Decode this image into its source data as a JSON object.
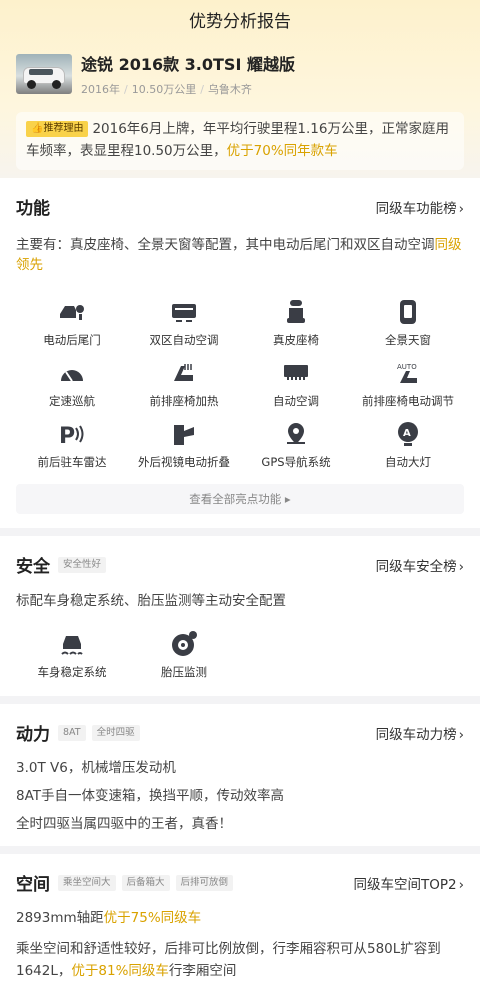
{
  "header": {
    "title": "优势分析报告"
  },
  "car": {
    "name": "途锐 2016款 3.0TSI 耀越版",
    "year": "2016年",
    "mileage": "10.50万公里",
    "city": "乌鲁木齐"
  },
  "reason": {
    "tag": "推荐理由",
    "text": "2016年6月上牌，年平均行驶里程1.16万公里，正常家庭用车频率，表显里程10.50万公里，",
    "highlight": "优于70%同年款车"
  },
  "function": {
    "title": "功能",
    "link": "同级车功能榜",
    "desc": "主要有：真皮座椅、全景天窗等配置，其中电动后尾门和双区自动空调",
    "desc_highlight": "同级领先",
    "items": [
      {
        "label": "电动后尾门",
        "icon": "power-tailgate-icon"
      },
      {
        "label": "双区自动空调",
        "icon": "dual-zone-ac-icon"
      },
      {
        "label": "真皮座椅",
        "icon": "leather-seat-icon"
      },
      {
        "label": "全景天窗",
        "icon": "panoramic-sunroof-icon"
      },
      {
        "label": "定速巡航",
        "icon": "cruise-control-icon"
      },
      {
        "label": "前排座椅加热",
        "icon": "seat-heating-icon"
      },
      {
        "label": "自动空调",
        "icon": "auto-ac-icon"
      },
      {
        "label": "前排座椅电动调节",
        "icon": "power-seat-icon"
      },
      {
        "label": "前后驻车雷达",
        "icon": "parking-radar-icon"
      },
      {
        "label": "外后视镜电动折叠",
        "icon": "mirror-fold-icon"
      },
      {
        "label": "GPS导航系统",
        "icon": "gps-icon"
      },
      {
        "label": "自动大灯",
        "icon": "auto-headlight-icon"
      }
    ],
    "view_all": "查看全部亮点功能 ▸"
  },
  "safety": {
    "title": "安全",
    "chip": "安全性好",
    "link": "同级车安全榜",
    "desc": "标配车身稳定系统、胎压监测等主动安全配置",
    "items": [
      {
        "label": "车身稳定系统",
        "icon": "stability-control-icon"
      },
      {
        "label": "胎压监测",
        "icon": "tire-pressure-icon"
      }
    ]
  },
  "power": {
    "title": "动力",
    "chips": [
      "8AT",
      "全时四驱"
    ],
    "link": "同级车动力榜",
    "lines": [
      "3.0T V6，机械增压发动机",
      "8AT手自一体变速箱，换挡平顺，传动效率高",
      "全时四驱当属四驱中的王者，真香！"
    ]
  },
  "space": {
    "title": "空间",
    "chips": [
      "乘坐空间大",
      "后备箱大",
      "后排可放倒"
    ],
    "link": "同级车空间TOP2",
    "wheelbase": "2893mm轴距",
    "wheelbase_highlight": "优于75%同级车",
    "desc": "乘坐空间和舒适性较好，后排可比例放倒，行李厢容积可从580L扩容到1642L，",
    "desc_highlight": "优于81%同级车",
    "desc_tail": "行李厢空间"
  },
  "colors": {
    "accent": "#d9a200",
    "tag_bg": "#f9d24a",
    "icon": "#3a3d45"
  }
}
